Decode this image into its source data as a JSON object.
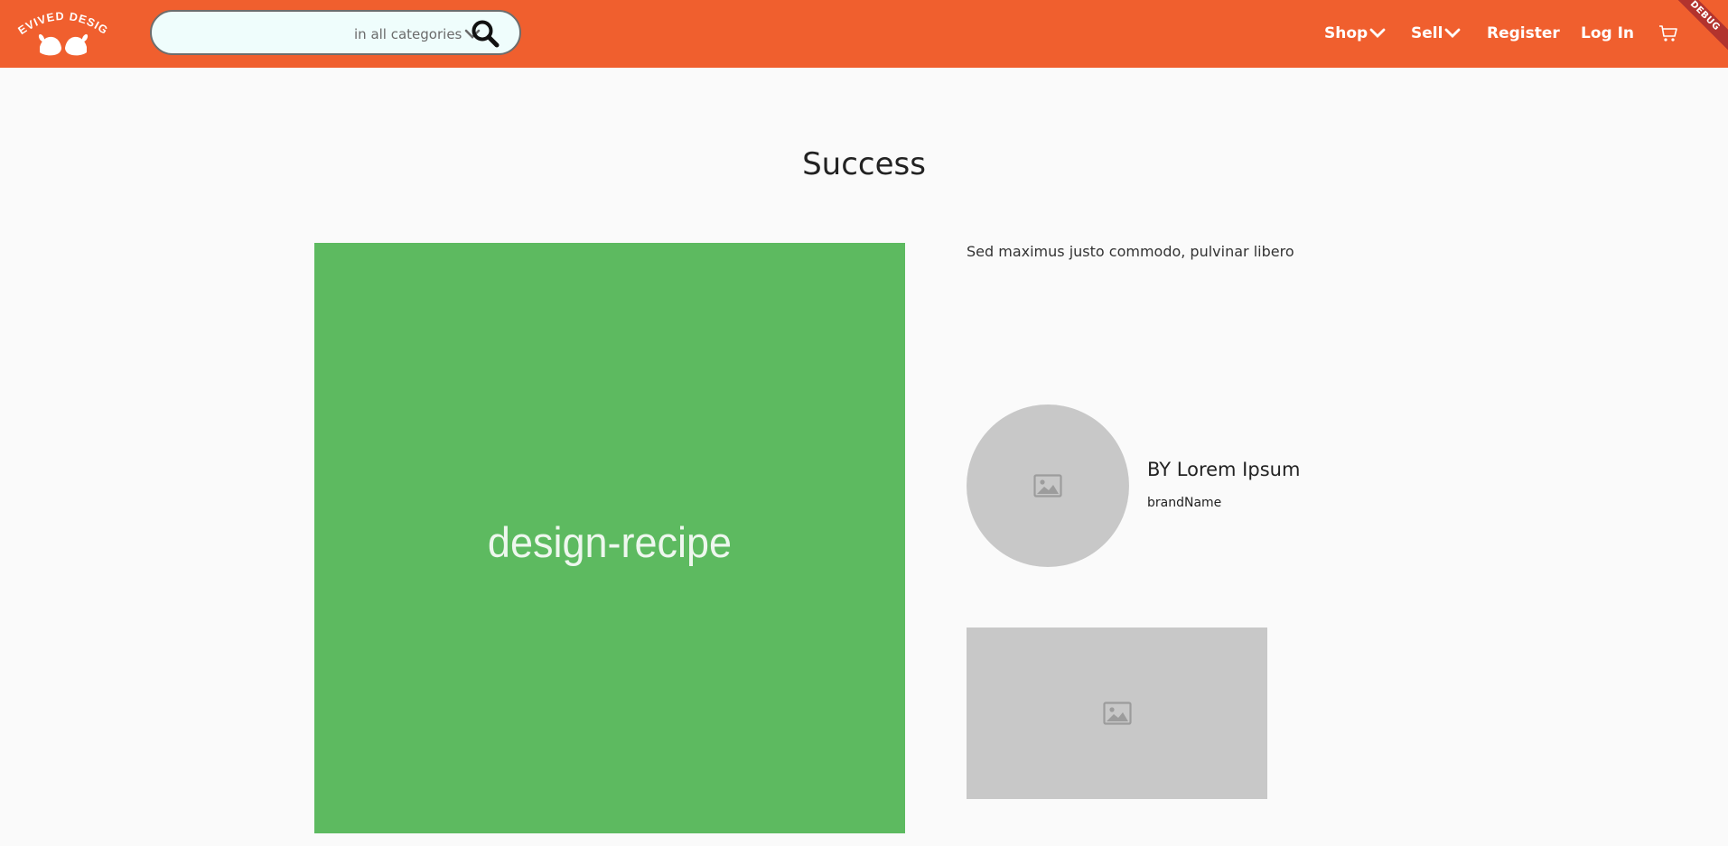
{
  "brand": {
    "logo_text": "REVIVED DESIGN"
  },
  "search": {
    "value": "",
    "category": "in all categories"
  },
  "nav": {
    "shop": "Shop",
    "sell": "Sell",
    "register": "Register",
    "login": "Log In"
  },
  "debug_banner": "DEBUG",
  "page": {
    "title": "Success",
    "image_label": "design-recipe",
    "description": "Sed maximus justo commodo, pulvinar libero",
    "author": "BY Lorem Ipsum",
    "brand_name": "brandName"
  },
  "colors": {
    "header": "#f05f2e",
    "hero": "#5dba60",
    "placeholder": "#c8c8c8"
  },
  "icons": [
    "logo-hands-icon",
    "chevron-down-icon",
    "search-icon",
    "cart-icon",
    "image-placeholder-icon"
  ]
}
